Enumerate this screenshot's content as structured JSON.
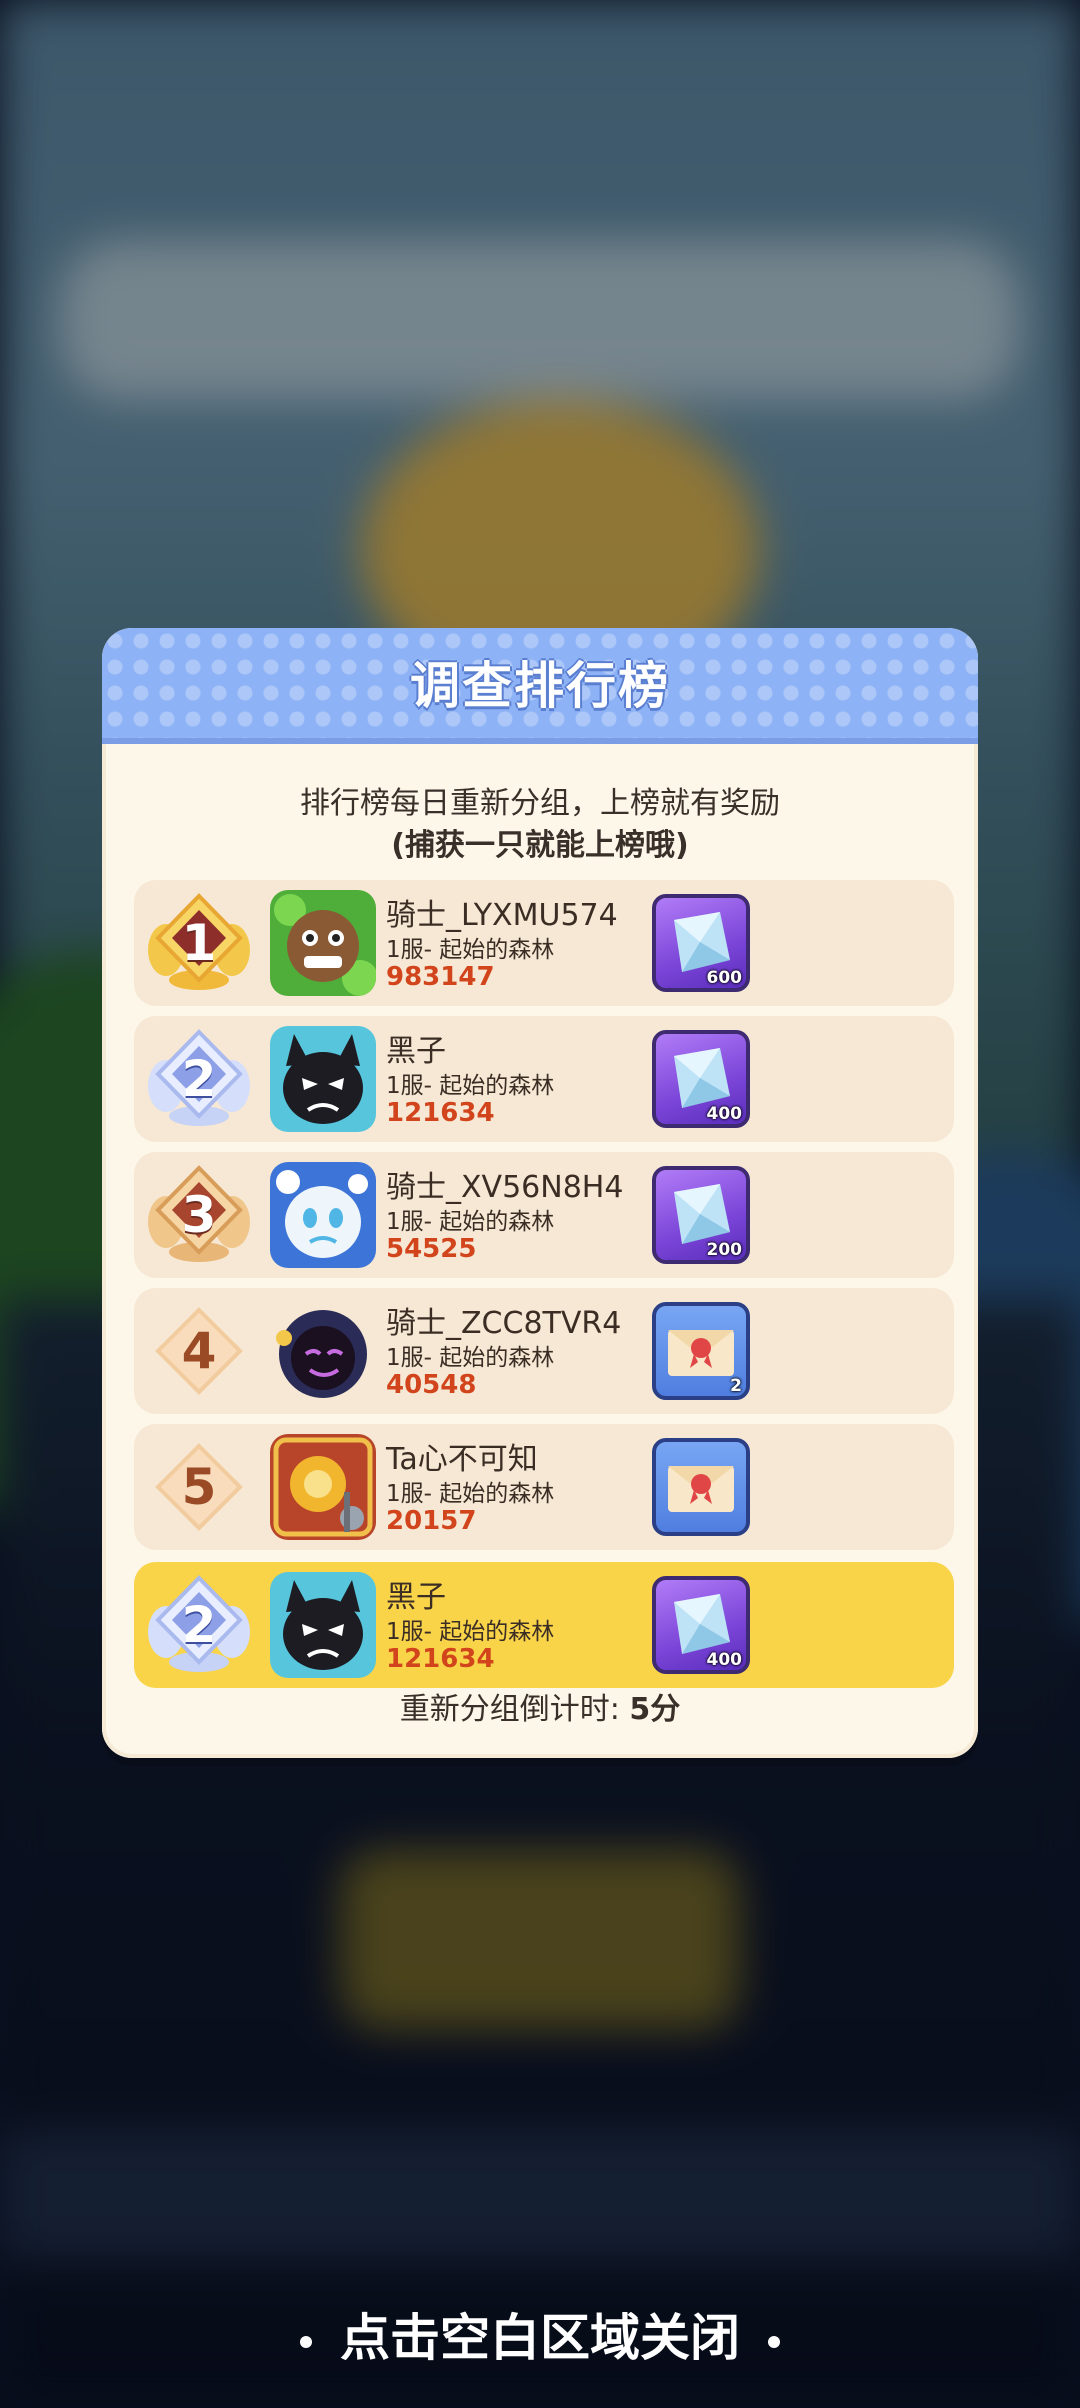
{
  "modal": {
    "title": "调查排行榜",
    "desc_line1": "排行榜每日重新分组，上榜就有奖励",
    "desc_line2": "(捕获一只就能上榜哦)",
    "countdown_label": "重新分组倒计时:",
    "countdown_value": "5分"
  },
  "rows": [
    {
      "rank": "1",
      "badge": "gold",
      "name": "骑士_LYXMU574",
      "server": "1服- 起始的森林",
      "score": "983147",
      "reward_type": "gem",
      "reward_count": "600",
      "avatar": "brown-monster-avatar"
    },
    {
      "rank": "2",
      "badge": "silver",
      "name": "黑子",
      "server": "1服- 起始的森林",
      "score": "121634",
      "reward_type": "gem",
      "reward_count": "400",
      "avatar": "black-cat-avatar"
    },
    {
      "rank": "3",
      "badge": "bronze",
      "name": "骑士_XV56N8H4",
      "server": "1服- 起始的森林",
      "score": "54525",
      "reward_type": "gem",
      "reward_count": "200",
      "avatar": "white-ghost-avatar"
    },
    {
      "rank": "4",
      "badge": "plain",
      "name": "骑士_ZCC8TVR4",
      "server": "1服- 起始的森林",
      "score": "40548",
      "reward_type": "mail",
      "reward_count": "2",
      "avatar": "shadow-monster-avatar"
    },
    {
      "rank": "5",
      "badge": "plain",
      "name": "Ta心不可知",
      "server": "1服- 起始的森林",
      "score": "20157",
      "reward_type": "mail",
      "reward_count": "",
      "avatar": "golden-warrior-avatar"
    }
  ],
  "me": {
    "rank": "2",
    "badge": "silver",
    "name": "黑子",
    "server": "1服- 起始的森林",
    "score": "121634",
    "reward_type": "gem",
    "reward_count": "400",
    "avatar": "black-cat-avatar"
  },
  "close_hint": "点击空白区域关闭",
  "colors": {
    "header": "#8db2f6",
    "panel": "#fdf7ea",
    "row": "#f6e8d4",
    "me_row": "#f9d449",
    "score": "#d2451c"
  }
}
